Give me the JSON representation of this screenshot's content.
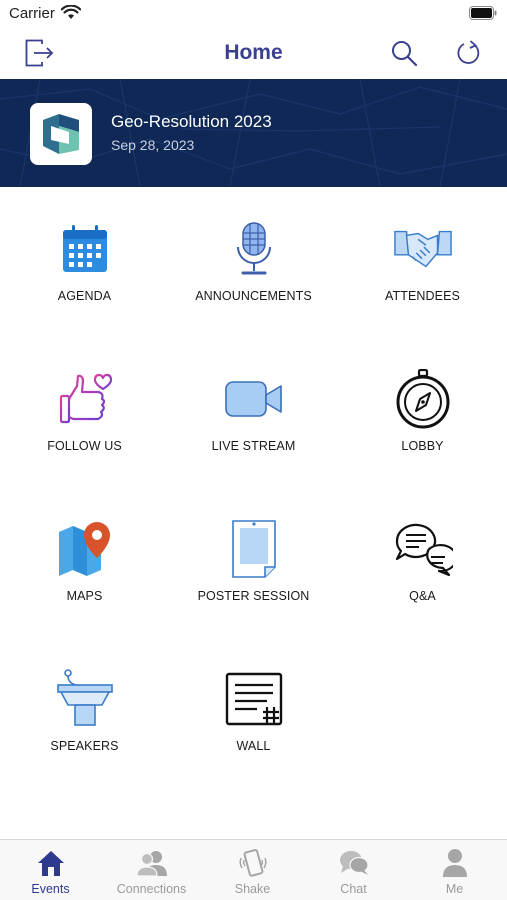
{
  "status_bar": {
    "carrier": "Carrier"
  },
  "nav": {
    "title": "Home",
    "left_icon": "logout-icon",
    "right_icons": [
      "search-icon",
      "refresh-icon"
    ],
    "accent_color": "#3b3f8f"
  },
  "event": {
    "name": "Geo-Resolution 2023",
    "date": "Sep 28, 2023",
    "banner_color": "#0f2856"
  },
  "tiles": [
    {
      "label": "AGENDA",
      "icon": "calendar-icon"
    },
    {
      "label": "ANNOUNCEMENTS",
      "icon": "microphone-icon"
    },
    {
      "label": "ATTENDEES",
      "icon": "handshake-icon"
    },
    {
      "label": "FOLLOW US",
      "icon": "thumbs-up-heart-icon"
    },
    {
      "label": "LIVE STREAM",
      "icon": "video-camera-icon"
    },
    {
      "label": "LOBBY",
      "icon": "compass-icon"
    },
    {
      "label": "MAPS",
      "icon": "map-pin-icon"
    },
    {
      "label": "POSTER SESSION",
      "icon": "poster-icon"
    },
    {
      "label": "Q&A",
      "icon": "chat-bubbles-icon"
    },
    {
      "label": "SPEAKERS",
      "icon": "podium-icon"
    },
    {
      "label": "WALL",
      "icon": "wall-post-icon"
    }
  ],
  "tab_bar": {
    "items": [
      {
        "label": "Events",
        "icon": "house-icon",
        "active": true
      },
      {
        "label": "Connections",
        "icon": "people-icon",
        "active": false
      },
      {
        "label": "Shake",
        "icon": "phone-shake-icon",
        "active": false
      },
      {
        "label": "Chat",
        "icon": "chat-icon",
        "active": false
      },
      {
        "label": "Me",
        "icon": "person-icon",
        "active": false
      }
    ],
    "active_color": "#2f3a8f",
    "inactive_color": "#9a9a9a"
  }
}
